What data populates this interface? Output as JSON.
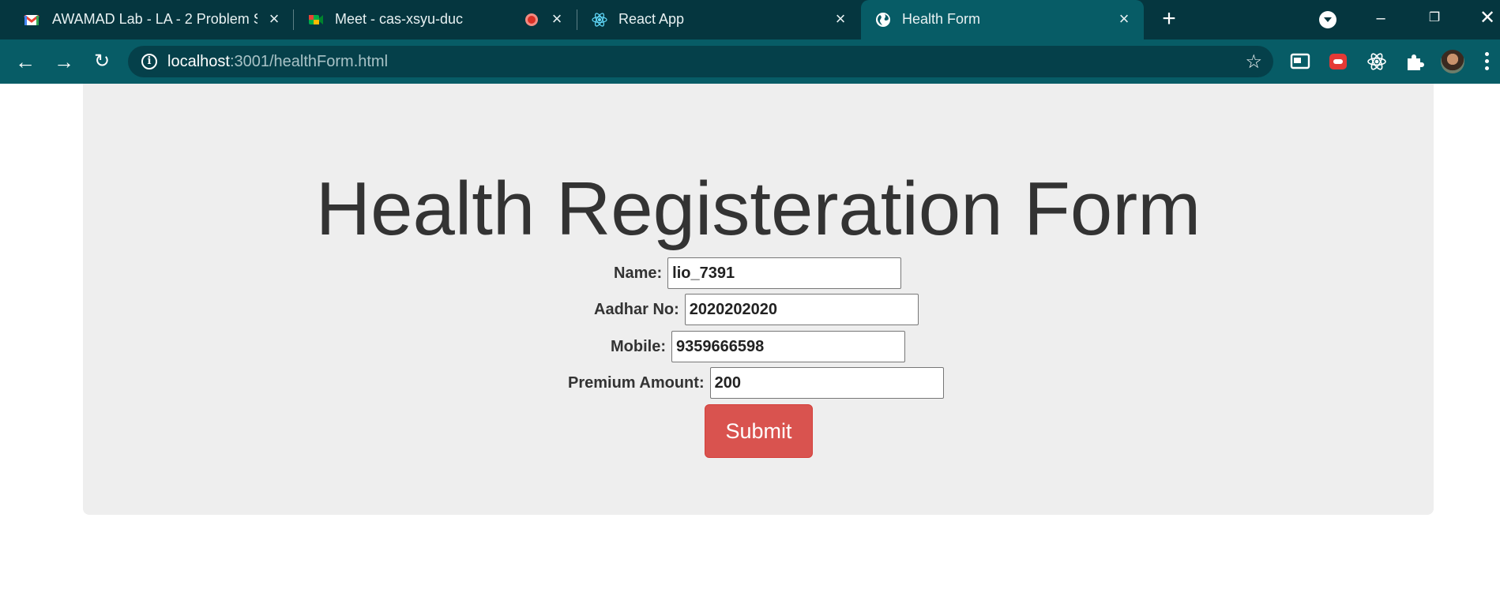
{
  "browser": {
    "tabs": [
      {
        "title": "AWAMAD Lab - LA - 2 Problem S",
        "icon": "gmail-icon"
      },
      {
        "title": "Meet - cas-xsyu-duc",
        "icon": "meet-icon"
      },
      {
        "title": "React App",
        "icon": "react-icon"
      },
      {
        "title": "Health Form",
        "icon": "globe-icon"
      }
    ],
    "url_host": "localhost",
    "url_rest": ":3001/healthForm.html"
  },
  "form": {
    "heading": "Health Registeration Form",
    "fields": [
      {
        "label": "Name:",
        "value": "lio_7391"
      },
      {
        "label": "Aadhar No:",
        "value": "2020202020"
      },
      {
        "label": "Mobile:",
        "value": "9359666598"
      },
      {
        "label": "Premium Amount:",
        "value": "200"
      }
    ],
    "submit_label": "Submit"
  },
  "colors": {
    "tabstrip": "#05363f",
    "toolbar": "#075c66",
    "jumbotron": "#eeeeee",
    "submit": "#d9534f"
  }
}
